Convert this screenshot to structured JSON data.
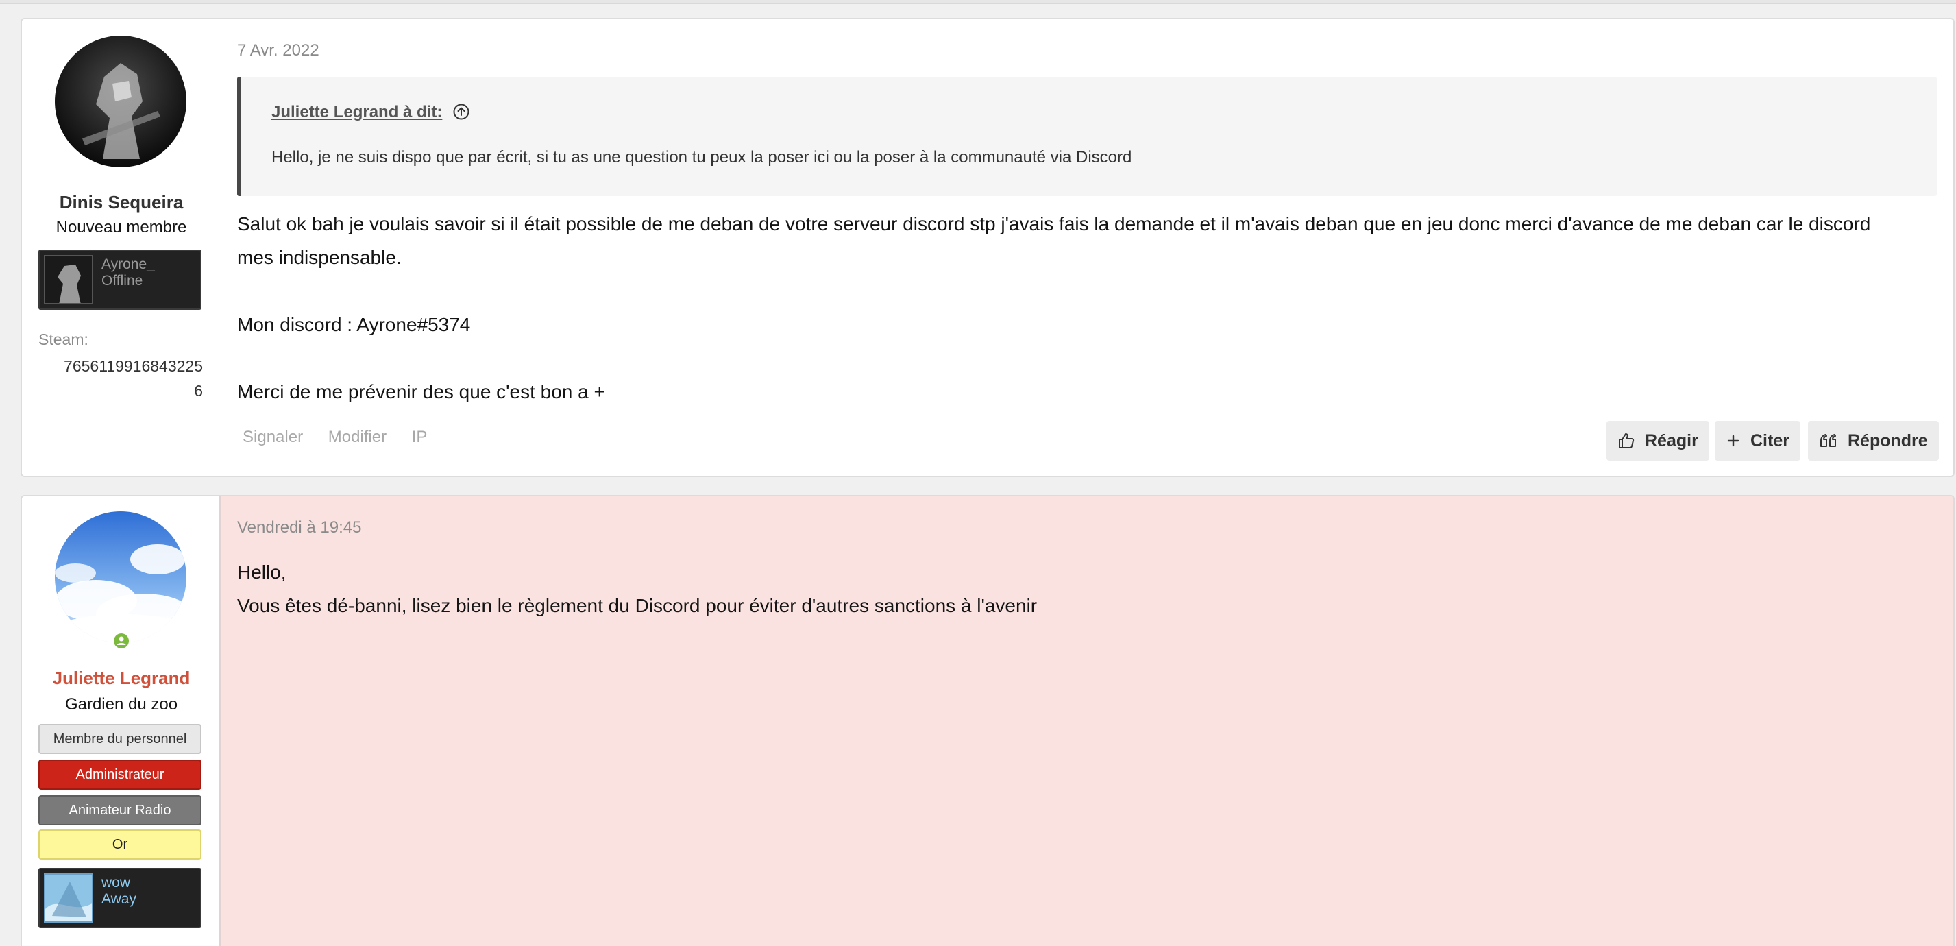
{
  "posts": [
    {
      "author": {
        "name": "Dinis Sequeira",
        "title": "Nouveau membre",
        "status_name": "Ayrone_",
        "status_state": "Offline",
        "field_label": "Steam:",
        "field_value_line1": "7656119916843225",
        "field_value_line2": "6"
      },
      "date": "7 Avr. 2022",
      "quote": {
        "header": "Juliette Legrand à dit:",
        "text": "Hello, je ne suis dispo que par écrit, si tu as une question tu peux la poser ici ou la poser à la communauté via Discord"
      },
      "body": {
        "line1": "Salut ok bah je voulais savoir si il était possible de me deban de votre serveur discord stp j'avais fais la demande et il m'avais deban que en jeu donc merci d'avance de me deban car le discord",
        "line2": "mes indispensable.",
        "line3": "Mon discord : Ayrone#5374",
        "line4": "Merci de me prévenir des que c'est bon a +"
      },
      "actions": {
        "report": "Signaler",
        "edit": "Modifier",
        "ip": "IP",
        "react": "Réagir",
        "quote": "Citer",
        "reply": "Répondre"
      }
    },
    {
      "author": {
        "name": "Juliette Legrand",
        "title": "Gardien du zoo",
        "banners": [
          "Membre du personnel",
          "Administrateur",
          "Animateur Radio",
          "Or"
        ],
        "status_name": "wow",
        "status_state": "Away"
      },
      "date": "Vendredi à 19:45",
      "body": {
        "line1": "Hello,",
        "line2": "Vous êtes dé-banni, lisez bien le règlement du Discord pour éviter d'autres sanctions à l'avenir"
      }
    }
  ],
  "colors": {
    "staff_name": "#d0503a",
    "admin_banner": "#cc2418",
    "radio_banner": "#7a7a7a",
    "gold_banner": "#fff89a",
    "staff_post_bg": "#f9e2e0"
  },
  "icons": {
    "quote_jump": "arrow-up-circle-icon",
    "react": "thumbs-up-icon",
    "quote": "plus-icon",
    "reply": "quote-marks-icon",
    "online": "user-online-icon"
  }
}
